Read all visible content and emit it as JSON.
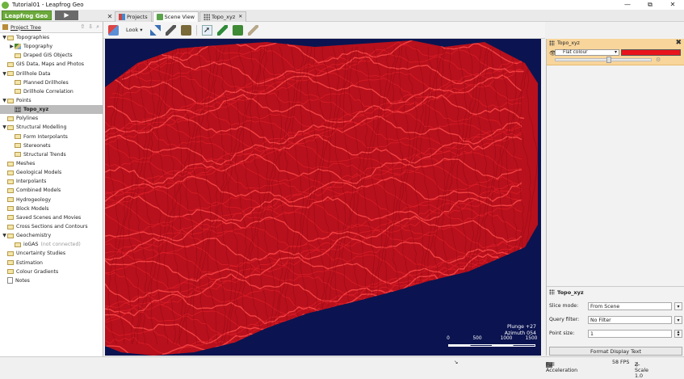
{
  "window": {
    "title": "Tutorial01 - Leapfrog Geo",
    "controls": [
      "—",
      "⧉",
      "✕"
    ]
  },
  "app_button": "Leapfrog Geo ▾",
  "play_button": "▶",
  "tabs": [
    {
      "label": "Projects"
    },
    {
      "label": "Scene View"
    },
    {
      "label": "Topo_xyz",
      "close": "✕"
    }
  ],
  "project_tree": {
    "header": "Project Tree",
    "items": [
      {
        "label": "Topographies",
        "level": 0,
        "toggle": "▼",
        "icon": "folder"
      },
      {
        "label": "Topography",
        "level": 1,
        "toggle": "▶",
        "icon": "topo"
      },
      {
        "label": "Draped GIS Objects",
        "level": 1,
        "toggle": "",
        "icon": "folder"
      },
      {
        "label": "GIS Data, Maps and Photos",
        "level": 0,
        "toggle": "",
        "icon": "folder"
      },
      {
        "label": "Drillhole Data",
        "level": 0,
        "toggle": "▼",
        "icon": "folder"
      },
      {
        "label": "Planned Drillholes",
        "level": 1,
        "toggle": "",
        "icon": "folder"
      },
      {
        "label": "Drillhole Correlation",
        "level": 1,
        "toggle": "",
        "icon": "folder"
      },
      {
        "label": "Points",
        "level": 0,
        "toggle": "▼",
        "icon": "folder"
      },
      {
        "label": "Topo_xyz",
        "level": 1,
        "toggle": "",
        "icon": "points",
        "selected": true
      },
      {
        "label": "Polylines",
        "level": 0,
        "toggle": "",
        "icon": "folder"
      },
      {
        "label": "Structural Modelling",
        "level": 0,
        "toggle": "▼",
        "icon": "folder"
      },
      {
        "label": "Form Interpolants",
        "level": 1,
        "toggle": "",
        "icon": "folder"
      },
      {
        "label": "Stereonets",
        "level": 1,
        "toggle": "",
        "icon": "folder"
      },
      {
        "label": "Structural Trends",
        "level": 1,
        "toggle": "",
        "icon": "folder"
      },
      {
        "label": "Meshes",
        "level": 0,
        "toggle": "",
        "icon": "folder"
      },
      {
        "label": "Geological Models",
        "level": 0,
        "toggle": "",
        "icon": "folder"
      },
      {
        "label": "Interpolants",
        "level": 0,
        "toggle": "",
        "icon": "folder"
      },
      {
        "label": "Combined Models",
        "level": 0,
        "toggle": "",
        "icon": "folder"
      },
      {
        "label": "Hydrogeology",
        "level": 0,
        "toggle": "",
        "icon": "folder"
      },
      {
        "label": "Block Models",
        "level": 0,
        "toggle": "",
        "icon": "folder"
      },
      {
        "label": "Saved Scenes and Movies",
        "level": 0,
        "toggle": "",
        "icon": "folder"
      },
      {
        "label": "Cross Sections and Contours",
        "level": 0,
        "toggle": "",
        "icon": "folder"
      },
      {
        "label": "Geochemistry",
        "level": 0,
        "toggle": "▼",
        "icon": "folder"
      },
      {
        "label": "ioGAS",
        "suffix": "(not connected)",
        "level": 1,
        "toggle": "",
        "icon": "folder"
      },
      {
        "label": "Uncertainty Studies",
        "level": 0,
        "toggle": "",
        "icon": "folder"
      },
      {
        "label": "Estimation",
        "level": 0,
        "toggle": "",
        "icon": "folder"
      },
      {
        "label": "Colour Gradients",
        "level": 0,
        "toggle": "",
        "icon": "folder"
      },
      {
        "label": "Notes",
        "level": 0,
        "toggle": "",
        "icon": "note"
      }
    ]
  },
  "toolbar": {
    "look_label": "Look ▾",
    "icons": [
      "eraser-icon",
      "axis-icon",
      "ruler-icon",
      "cube-icon",
      "cursor-icon",
      "pencil-icon",
      "box-icon",
      "slice-icon"
    ]
  },
  "scene": {
    "background": "#0b1450",
    "plunge": "Plunge +27",
    "azimuth": "Azimuth 054",
    "scale_labels": [
      "0",
      "500",
      "1000",
      "1500"
    ]
  },
  "layer": {
    "name": "Topo_xyz",
    "colour_mode": "Flat colour",
    "colour": "#e8141c",
    "opacity_fraction": 0.55
  },
  "properties": {
    "title": "Topo_xyz",
    "slice_mode_label": "Slice mode:",
    "slice_mode_value": "From Scene",
    "query_filter_label": "Query filter:",
    "query_filter_value": "No Filter",
    "point_size_label": "Point size:",
    "point_size_value": "1",
    "format_button": "Format Display Text"
  },
  "status": {
    "acceleration": "Full Acceleration",
    "fps": "58 FPS",
    "zscale": "Z-Scale 1.0"
  }
}
